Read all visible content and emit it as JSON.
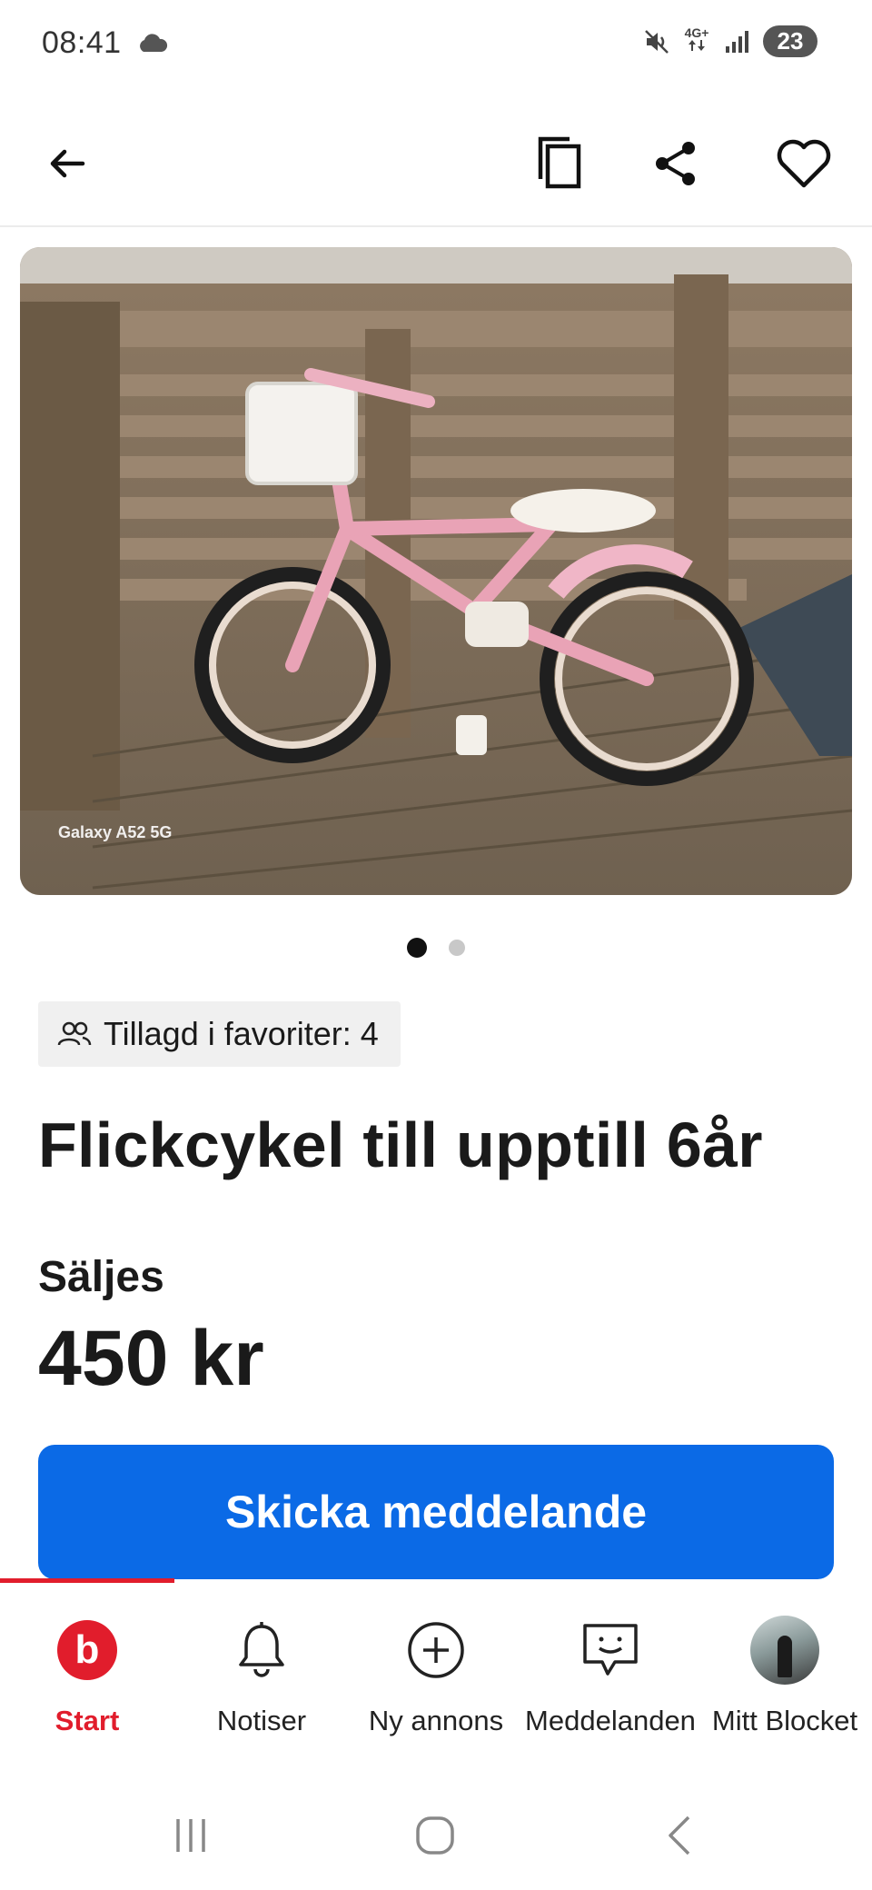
{
  "status_bar": {
    "time": "08:41",
    "cloud_icon": "cloud-icon",
    "mute_icon": "vibrate-mute-icon",
    "network_label": "4G+",
    "signal_icon": "signal-bars-icon",
    "battery": "23"
  },
  "toolbar": {
    "back_icon": "arrow-left-icon",
    "copy_icon": "copy-icon",
    "share_icon": "share-icon",
    "favorite_icon": "heart-outline-icon"
  },
  "listing": {
    "image_caption": "Galaxy A52 5G",
    "image_count": 2,
    "current_image": 1,
    "favorites_label": "Tillagd i favoriter: 4",
    "title": "Flickcykel till upptill 6år",
    "sale_type": "Säljes",
    "price": "450 kr"
  },
  "cta": {
    "label": "Skicka meddelande"
  },
  "bottom_nav": {
    "items": [
      {
        "label": "Start",
        "icon": "blocket-logo-icon",
        "active": true
      },
      {
        "label": "Notiser",
        "icon": "bell-icon",
        "active": false
      },
      {
        "label": "Ny annons",
        "icon": "plus-circle-icon",
        "active": false
      },
      {
        "label": "Meddelanden",
        "icon": "chat-smile-icon",
        "active": false
      },
      {
        "label": "Mitt Blocket",
        "icon": "avatar",
        "active": false
      }
    ]
  },
  "colors": {
    "accent_blue": "#0b6ae6",
    "brand_red": "#e11d2c",
    "chip_bg": "#f0f0f0"
  }
}
